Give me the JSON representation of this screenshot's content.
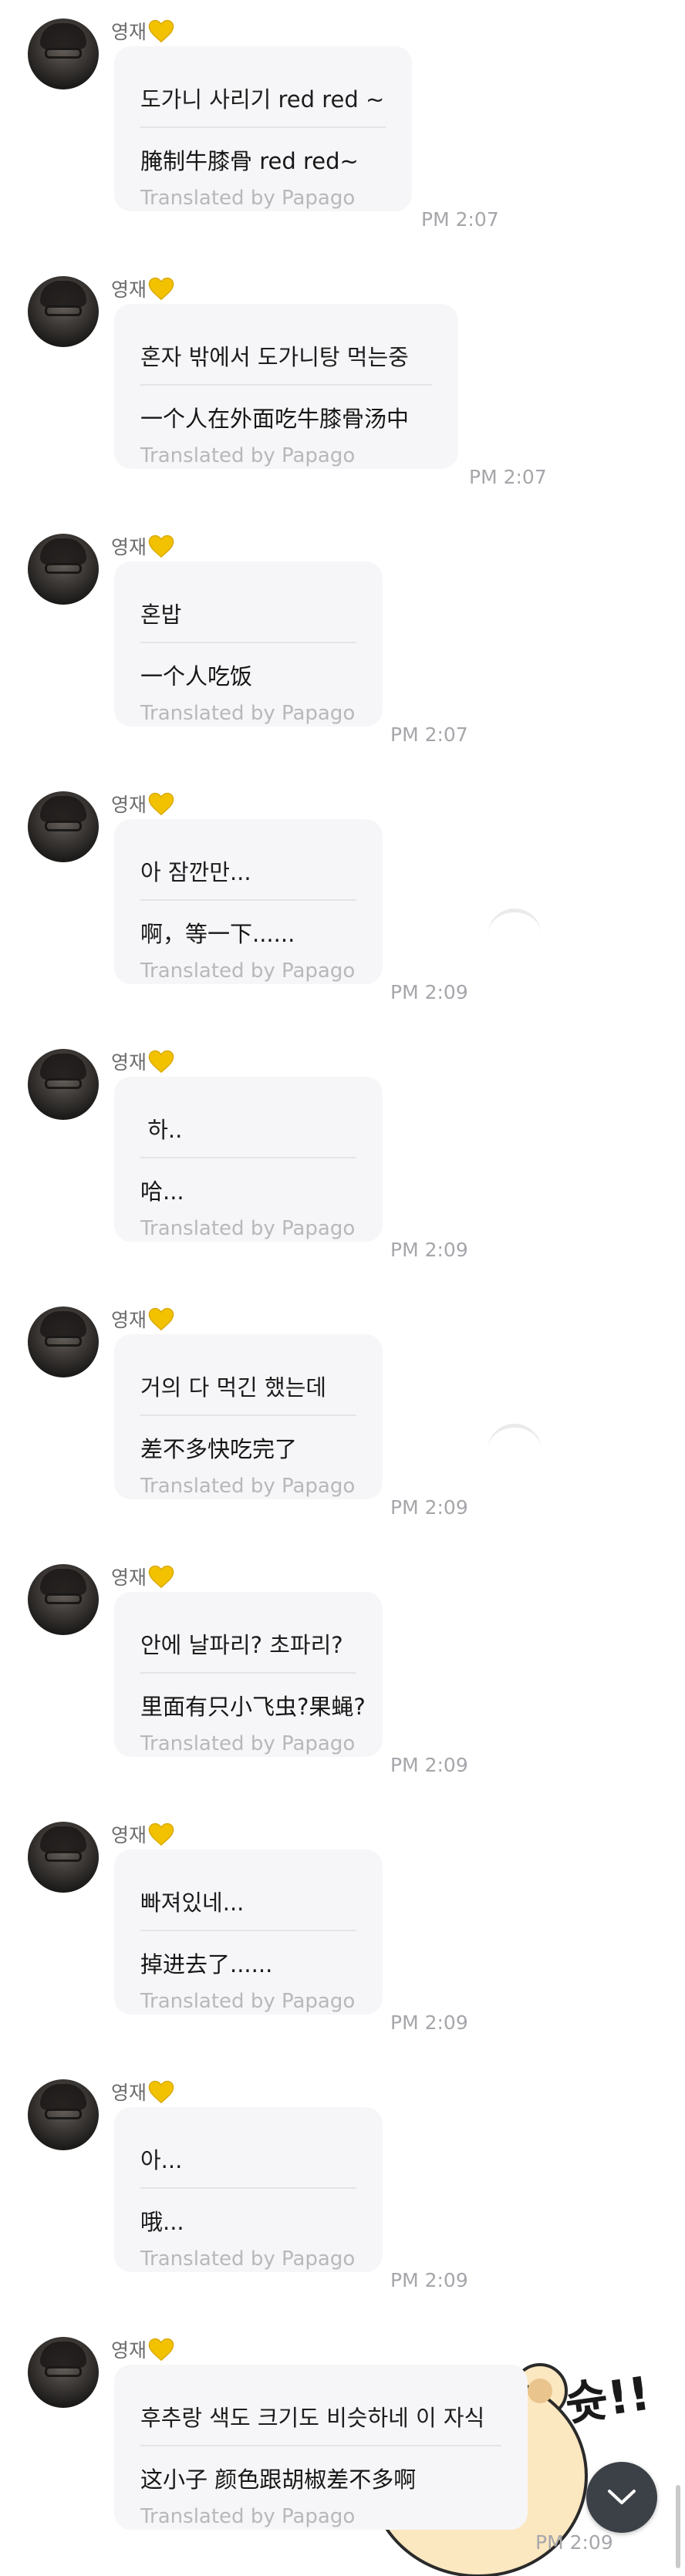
{
  "sender_name": "영재",
  "credit_label": "Translated by Papago",
  "colors": {
    "bubble": "#f6f6f8",
    "time": "#a6a6ab",
    "credit": "#b8b8bc",
    "heart": "#f2c200"
  },
  "icons": {
    "sender_badge": "yellow-heart-icon",
    "scroll_button": "chevron-down-icon",
    "sticker": "bear-sticker"
  },
  "sticker": {
    "text": "슛!!"
  },
  "messages": [
    {
      "original": "도가니 사리기 red red ~",
      "translation": "腌制牛膝骨 red red~",
      "time": "PM 2:07"
    },
    {
      "original": "혼자 밖에서 도가니탕 먹는중",
      "translation": "一个人在外面吃牛膝骨汤中",
      "time": "PM 2:07"
    },
    {
      "original": "혼밥",
      "translation": "一个人吃饭",
      "time": "PM 2:07"
    },
    {
      "original": "아 잠깐만...",
      "translation": "啊，等一下......",
      "time": "PM 2:09"
    },
    {
      "original": " 하..",
      "translation": "哈...",
      "time": "PM 2:09"
    },
    {
      "original": "거의 다 먹긴 했는데",
      "translation": "差不多快吃完了",
      "time": "PM 2:09"
    },
    {
      "original": "안에 날파리? 초파리?",
      "translation": "里面有只小飞虫?果蝇?",
      "time": "PM 2:09"
    },
    {
      "original": "빠져있네...",
      "translation": "掉进去了......",
      "time": "PM 2:09"
    },
    {
      "original": "아...",
      "translation": "哦...",
      "time": "PM 2:09"
    },
    {
      "original": "후추랑 색도 크기도 비슷하네 이 자식",
      "translation": "这小子 颜色跟胡椒差不多啊",
      "time": "PM 2:09"
    }
  ]
}
